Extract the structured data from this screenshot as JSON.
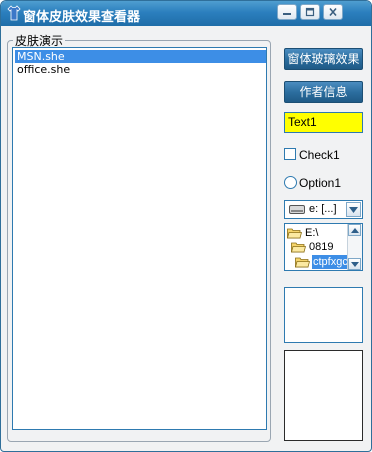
{
  "window": {
    "title": "窗体皮肤效果查看器",
    "icon": "tshirt-icon",
    "controls": [
      "minimize-icon",
      "maximize-icon",
      "close-icon"
    ]
  },
  "skin_group": {
    "label": "皮肤演示",
    "items": [
      {
        "label": "MSN.she",
        "selected": true
      },
      {
        "label": "office.she",
        "selected": false
      }
    ]
  },
  "buttons": {
    "glass_effect": "窗体玻璃效果",
    "author_info": "作者信息"
  },
  "text_field": {
    "value": "Text1",
    "background": "#ffff00"
  },
  "checkbox": {
    "label": "Check1",
    "checked": false
  },
  "option": {
    "label": "Option1",
    "selected": false
  },
  "drive": {
    "value": "e: [...]",
    "icon": "drive-icon"
  },
  "dirs": [
    {
      "label": "E:\\",
      "selected": false
    },
    {
      "label": "0819",
      "selected": false
    },
    {
      "label": "ctpfxgc",
      "selected": true
    }
  ],
  "colors": {
    "titlebar": "#2b7fbe",
    "border_blue": "#2e7ab0",
    "selection": "#3d8ee6"
  }
}
